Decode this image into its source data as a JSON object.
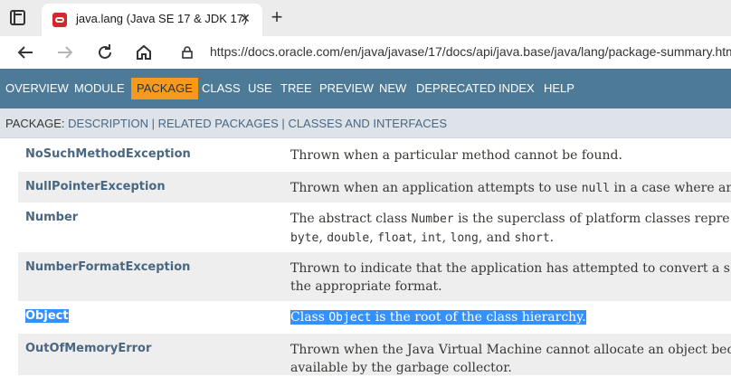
{
  "browser": {
    "tab_title": "java.lang (Java SE 17 & JDK 17)",
    "tab_close": "✕",
    "new_tab": "+",
    "url": "https://docs.oracle.com/en/java/javase/17/docs/api/java.base/java/lang/package-summary.htm",
    "icons": [
      "tab-actions-icon",
      "oracle-favicon-icon",
      "close-icon",
      "plus-icon",
      "back-arrow-icon",
      "forward-arrow-icon",
      "refresh-icon",
      "home-icon",
      "lock-icon"
    ]
  },
  "nav": {
    "items": [
      "OVERVIEW",
      "MODULE",
      "PACKAGE",
      "CLASS",
      "USE",
      "TREE",
      "PREVIEW",
      "NEW",
      "DEPRECATED",
      "INDEX",
      "HELP"
    ],
    "active": "PACKAGE",
    "bar_color": "#4d7a97",
    "active_color": "#f8981d"
  },
  "subnav": {
    "label": "PACKAGE:",
    "links": [
      "DESCRIPTION",
      "RELATED PACKAGES",
      "CLASSES AND INTERFACES"
    ],
    "separator": "|"
  },
  "rows": [
    {
      "name": "NoSuchMethodException",
      "desc_lines": [
        [
          {
            "t": "Thrown when a particular method cannot be found."
          }
        ]
      ]
    },
    {
      "name": "NullPointerException",
      "desc_lines": [
        [
          {
            "t": "Thrown when an application attempts to use "
          },
          {
            "c": "null"
          },
          {
            "t": " in a case where an"
          }
        ]
      ]
    },
    {
      "name": "Number",
      "desc_lines": [
        [
          {
            "t": "The abstract class "
          },
          {
            "c": "Number"
          },
          {
            "t": " is the superclass of platform classes repre"
          }
        ],
        [
          {
            "c": "byte"
          },
          {
            "t": ", "
          },
          {
            "c": "double"
          },
          {
            "t": ", "
          },
          {
            "c": "float"
          },
          {
            "t": ", "
          },
          {
            "c": "int"
          },
          {
            "t": ", "
          },
          {
            "c": "long"
          },
          {
            "t": ", and "
          },
          {
            "c": "short"
          },
          {
            "t": "."
          }
        ]
      ]
    },
    {
      "name": "NumberFormatException",
      "desc_lines": [
        [
          {
            "t": "Thrown to indicate that the application has attempted to convert a s"
          }
        ],
        [
          {
            "t": "the appropriate format."
          }
        ]
      ]
    },
    {
      "name": "Object",
      "selected": true,
      "desc_lines": [
        [
          {
            "t": "Class "
          },
          {
            "c": "Object"
          },
          {
            "t": " is the root of the class hierarchy."
          }
        ]
      ]
    },
    {
      "name": "OutOfMemoryError",
      "desc_lines": [
        [
          {
            "t": "Thrown when the Java Virtual Machine cannot allocate an object bec"
          }
        ],
        [
          {
            "t": "available by the garbage collector."
          }
        ]
      ]
    }
  ],
  "colors": {
    "class_link": "#4a6782",
    "row_alt": "#eeeeef",
    "selection": "#3390ff"
  }
}
